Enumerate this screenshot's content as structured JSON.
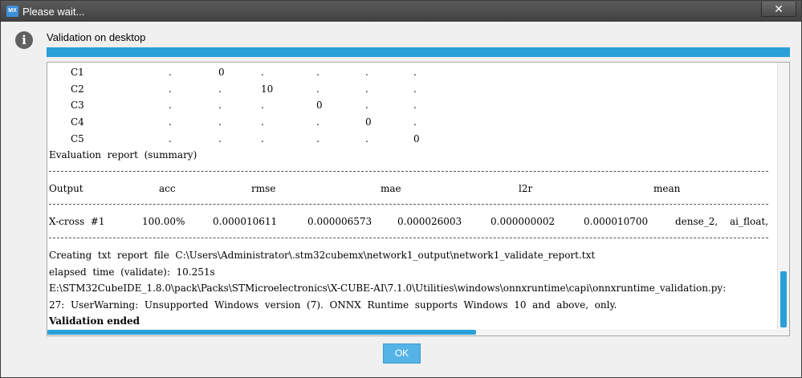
{
  "window": {
    "title": "Please wait...",
    "app_icon_text": "MX",
    "close_glyph": "✕"
  },
  "dialog": {
    "heading": "Validation on desktop",
    "progress_fraction": 1.0,
    "ok_label": "OK"
  },
  "console": {
    "confusion_rows": [
      {
        "label": "C1",
        "cells": [
          ".",
          "0",
          ".",
          ".",
          ".",
          "."
        ]
      },
      {
        "label": "C2",
        "cells": [
          ".",
          ".",
          "10",
          ".",
          ".",
          "."
        ]
      },
      {
        "label": "C3",
        "cells": [
          ".",
          ".",
          ".",
          "0",
          ".",
          "."
        ]
      },
      {
        "label": "C4",
        "cells": [
          ".",
          ".",
          ".",
          ".",
          "0",
          "."
        ]
      },
      {
        "label": "C5",
        "cells": [
          ".",
          ".",
          ".",
          ".",
          ".",
          "0"
        ]
      }
    ],
    "summary_title": "Evaluation  report  (summary)",
    "columns": [
      "Output",
      "acc",
      "rmse",
      "mae",
      "l2r",
      "mean"
    ],
    "row": [
      "X-cross  #1",
      "100.00%",
      "0.000010611",
      "0.000006573",
      "0.000026003",
      "0.000000002",
      "0.000010700",
      "dense_2,",
      "ai_float,"
    ],
    "lines": [
      "Creating  txt  report  file  C:\\Users\\Administrator\\.stm32cubemx\\network1_output\\network1_validate_report.txt",
      "elapsed  time  (validate):  10.251s",
      "E:\\STM32CubeIDE_1.8.0\\pack\\Packs\\STMicroelectronics\\X-CUBE-AI\\7.1.0\\Utilities\\windows\\onnxruntime\\capi\\onnxruntime_validation.py:",
      "27:  UserWarning:  Unsupported  Windows  version  (7).  ONNX  Runtime  supports  Windows  10  and  above,  only."
    ],
    "final_line": "Validation ended",
    "vertical_scroll_fraction": 0.92,
    "horizontal_scroll_fraction": 0.0
  }
}
